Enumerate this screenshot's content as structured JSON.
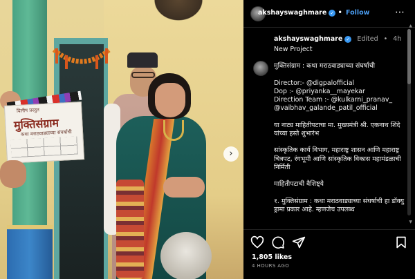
{
  "header": {
    "username": "akshayswaghmare",
    "follow_label": "Follow",
    "separator": "•"
  },
  "caption": {
    "username": "akshayswaghmare",
    "edited_label": "Edited",
    "time_short": "4h",
    "text": "New Project\n\nमुक्तिसंग्राम : कथा मराठवाड्याच्या संघर्षाची\n\nDirector:- @digpalofficial\nDop :- @priyanka__mayekar\nDirection Team :- @kulkarni_pranav_\n@vaibhav_galande_patil_official\n\nया नाट्य माहितीपटाचा मा. मुख्यमंत्री श्री. एकनाथ शिंदे यांच्या हस्ते शुभारंभ\n\nसांस्कृतिक कार्य विभाग, महाराष्ट्र शासन आणि महाराष्ट्र चित्रपट, रंगभूमी आणि सांस्कृतिक विकास महामंडळाची निर्मिती\n\nमाहितीपटाची वैशिष्ट्ये\n\n१. मुक्तिसंग्राम : कथा मराठवाड्याच्या संघर्षाची हा डॉक्यु ड्रामा प्रकार आहे. म्हणजेच उपलब्ध"
  },
  "footer": {
    "likes": "1,805 likes",
    "time_ago": "4 HOURS AGO"
  },
  "clapperboard": {
    "subtitle": "दिलीप प्रस्तुत",
    "title": "मुक्तिसंग्राम",
    "description": "कथा मराठवाड्याच्या संघर्षाची"
  },
  "icons": {
    "more": "more-options-icon",
    "verified": "verified-badge-icon",
    "heart": "heart-icon",
    "comment": "comment-icon",
    "share": "share-icon",
    "save": "bookmark-icon",
    "next": "chevron-right-icon"
  },
  "colors": {
    "background": "#000000",
    "accent": "#4a9cf0",
    "verified": "#3897f0",
    "muted": "#a8a8a8"
  }
}
